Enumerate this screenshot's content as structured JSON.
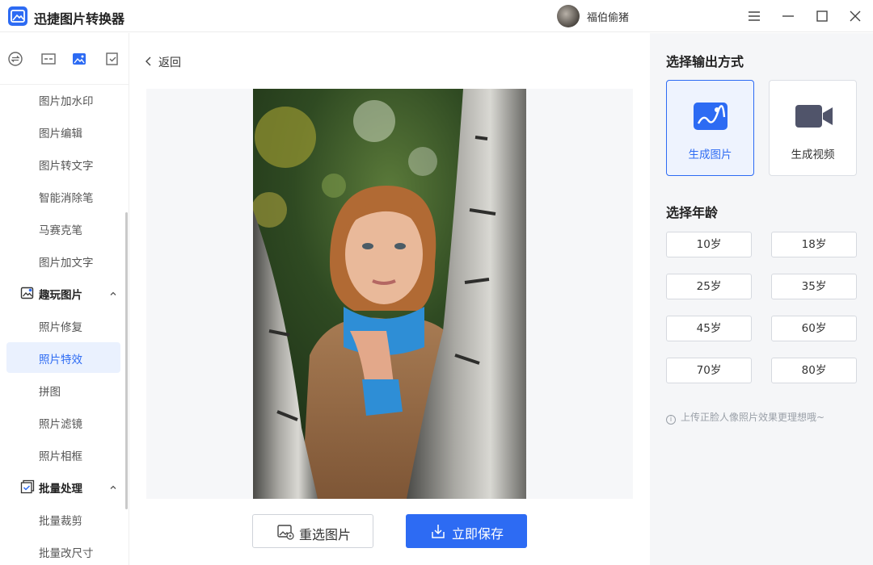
{
  "app": {
    "title": "迅捷图片转换器"
  },
  "user": {
    "name": "福伯偷猪"
  },
  "window_controls": [
    "menu-icon",
    "minimize-icon",
    "maximize-icon",
    "close-icon"
  ],
  "sidebar": {
    "tab_icons": [
      "convert-icon",
      "compress-icon",
      "image-icon",
      "checklist-icon"
    ],
    "items_top": [
      {
        "label": "图片加水印"
      },
      {
        "label": "图片编辑"
      },
      {
        "label": "图片转文字"
      },
      {
        "label": "智能消除笔"
      },
      {
        "label": "马赛克笔"
      },
      {
        "label": "图片加文字"
      }
    ],
    "group_fun": {
      "label": "趣玩图片",
      "icon": "fun-image-icon",
      "expanded": true
    },
    "items_fun": [
      {
        "label": "照片修复"
      },
      {
        "label": "照片特效",
        "active": true
      },
      {
        "label": "拼图"
      },
      {
        "label": "照片滤镜"
      },
      {
        "label": "照片相框"
      }
    ],
    "group_batch": {
      "label": "批量处理",
      "icon": "batch-icon",
      "expanded": true
    },
    "items_batch": [
      {
        "label": "批量裁剪"
      },
      {
        "label": "批量改尺寸"
      }
    ]
  },
  "main": {
    "back_label": "返回",
    "reselect_label": "重选图片",
    "save_label": "立即保存"
  },
  "right": {
    "output_title": "选择输出方式",
    "modes": [
      {
        "label": "生成图片",
        "icon": "image-icon",
        "selected": true
      },
      {
        "label": "生成视频",
        "icon": "video-icon",
        "selected": false
      }
    ],
    "age_title": "选择年龄",
    "ages": [
      "10岁",
      "18岁",
      "25岁",
      "35岁",
      "45岁",
      "60岁",
      "70岁",
      "80岁"
    ],
    "hint": "上传正脸人像照片效果更理想哦~"
  },
  "colors": {
    "accent": "#2d6bf3",
    "panel_bg": "#f5f6f8",
    "active_bg": "#eaf1fe"
  }
}
